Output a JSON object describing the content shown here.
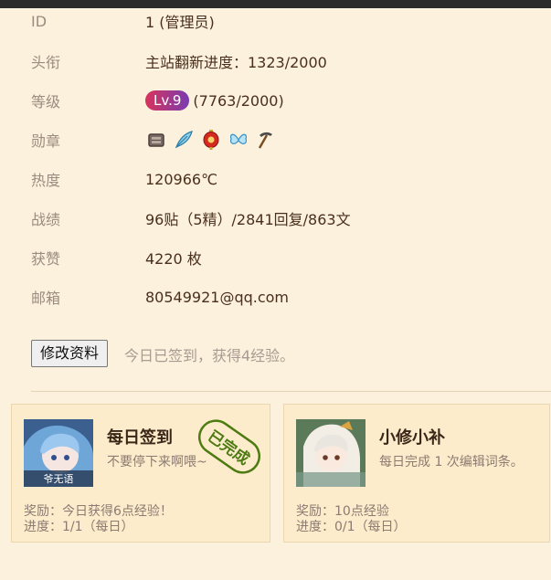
{
  "profile": {
    "rows": [
      {
        "label": "ID",
        "value": "1 (管理员)"
      },
      {
        "label": "头衔",
        "value": "主站翻新进度：1323/2000"
      },
      {
        "label": "等级",
        "badge": "Lv.9",
        "value": "(7763/2000)"
      },
      {
        "label": "勋章"
      },
      {
        "label": "热度",
        "value": "120966℃"
      },
      {
        "label": "战绩",
        "value": "96贴（5精）/2841回复/863文"
      },
      {
        "label": "获赞",
        "value": "4220 枚"
      },
      {
        "label": "邮箱",
        "value": "80549921@qq.com"
      }
    ],
    "medals": [
      "chest-medal-icon",
      "feather-medal-icon",
      "lantern-medal-icon",
      "butterfly-medal-icon",
      "pickaxe-medal-icon"
    ]
  },
  "actions": {
    "edit_label": "修改资料",
    "sign_note": "今日已签到，获得4经验。"
  },
  "tasks": [
    {
      "title": "每日签到",
      "desc": "不要停下来啊喂~",
      "reward": "奖励：今日获得6点经验！",
      "progress": "进度：1/1（每日）",
      "stamp": "已完成",
      "avatar_caption": "爷无语"
    },
    {
      "title": "小修小补",
      "desc": "每日完成 1 次编辑词条。",
      "reward": "奖励：10点经验",
      "progress": "进度：0/1（每日）"
    }
  ],
  "colors": {
    "background": "#fbf1dc",
    "card_bg": "#fdeccb",
    "link": "#1a1ad6",
    "stamp": "#4d7a12",
    "level_badge_start": "#d7345c",
    "level_badge_end": "#7a3bb0"
  }
}
